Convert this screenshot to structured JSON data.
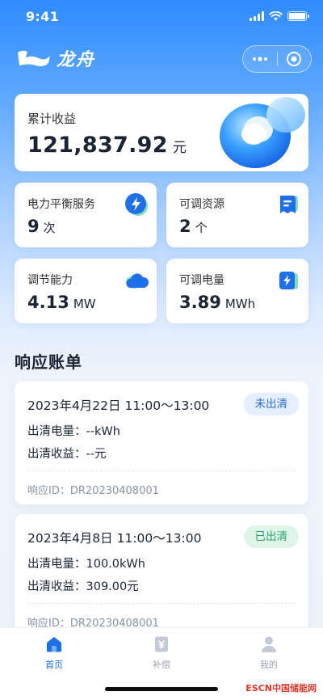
{
  "status_bar": {
    "time": "9:41"
  },
  "header": {
    "logo_text": "龙舟"
  },
  "summary": {
    "label": "累计收益",
    "value": "121,837.92",
    "unit": "元"
  },
  "stats": [
    {
      "label": "电力平衡服务",
      "value": "9",
      "unit": "次",
      "icon": "lightning-icon"
    },
    {
      "label": "可调资源",
      "value": "2",
      "unit": "个",
      "icon": "document-icon"
    },
    {
      "label": "调节能力",
      "value": "4.13",
      "unit": "MW",
      "icon": "cloud-icon"
    },
    {
      "label": "可调电量",
      "value": "3.89",
      "unit": "MWh",
      "icon": "battery-charge-icon"
    }
  ],
  "section_title": "响应账单",
  "bills": [
    {
      "date": "2023年4月22日 11:00～13:00",
      "status": "未出清",
      "energy_label": "出清电量：",
      "energy": "--kWh",
      "income_label": "出清收益：",
      "income": "--元",
      "id_label": "响应ID：",
      "id": "DR20230408001"
    },
    {
      "date": "2023年4月8日 11:00～13:00",
      "status": "已出清",
      "energy_label": "出清电量：",
      "energy": "100.0kWh",
      "income_label": "出清收益：",
      "income": "309.00元",
      "id_label": "响应ID：",
      "id": "DR20230408001"
    }
  ],
  "tabs": [
    {
      "label": "首页",
      "icon": "home-icon",
      "active": true
    },
    {
      "label": "补偿",
      "icon": "compensation-icon",
      "active": false
    },
    {
      "label": "我的",
      "icon": "user-icon",
      "active": false
    }
  ],
  "watermark": "ESCN中国储能网",
  "colors": {
    "primary": "#1f6fe8",
    "pending": "#2f6fe0",
    "done": "#2aa36a"
  }
}
